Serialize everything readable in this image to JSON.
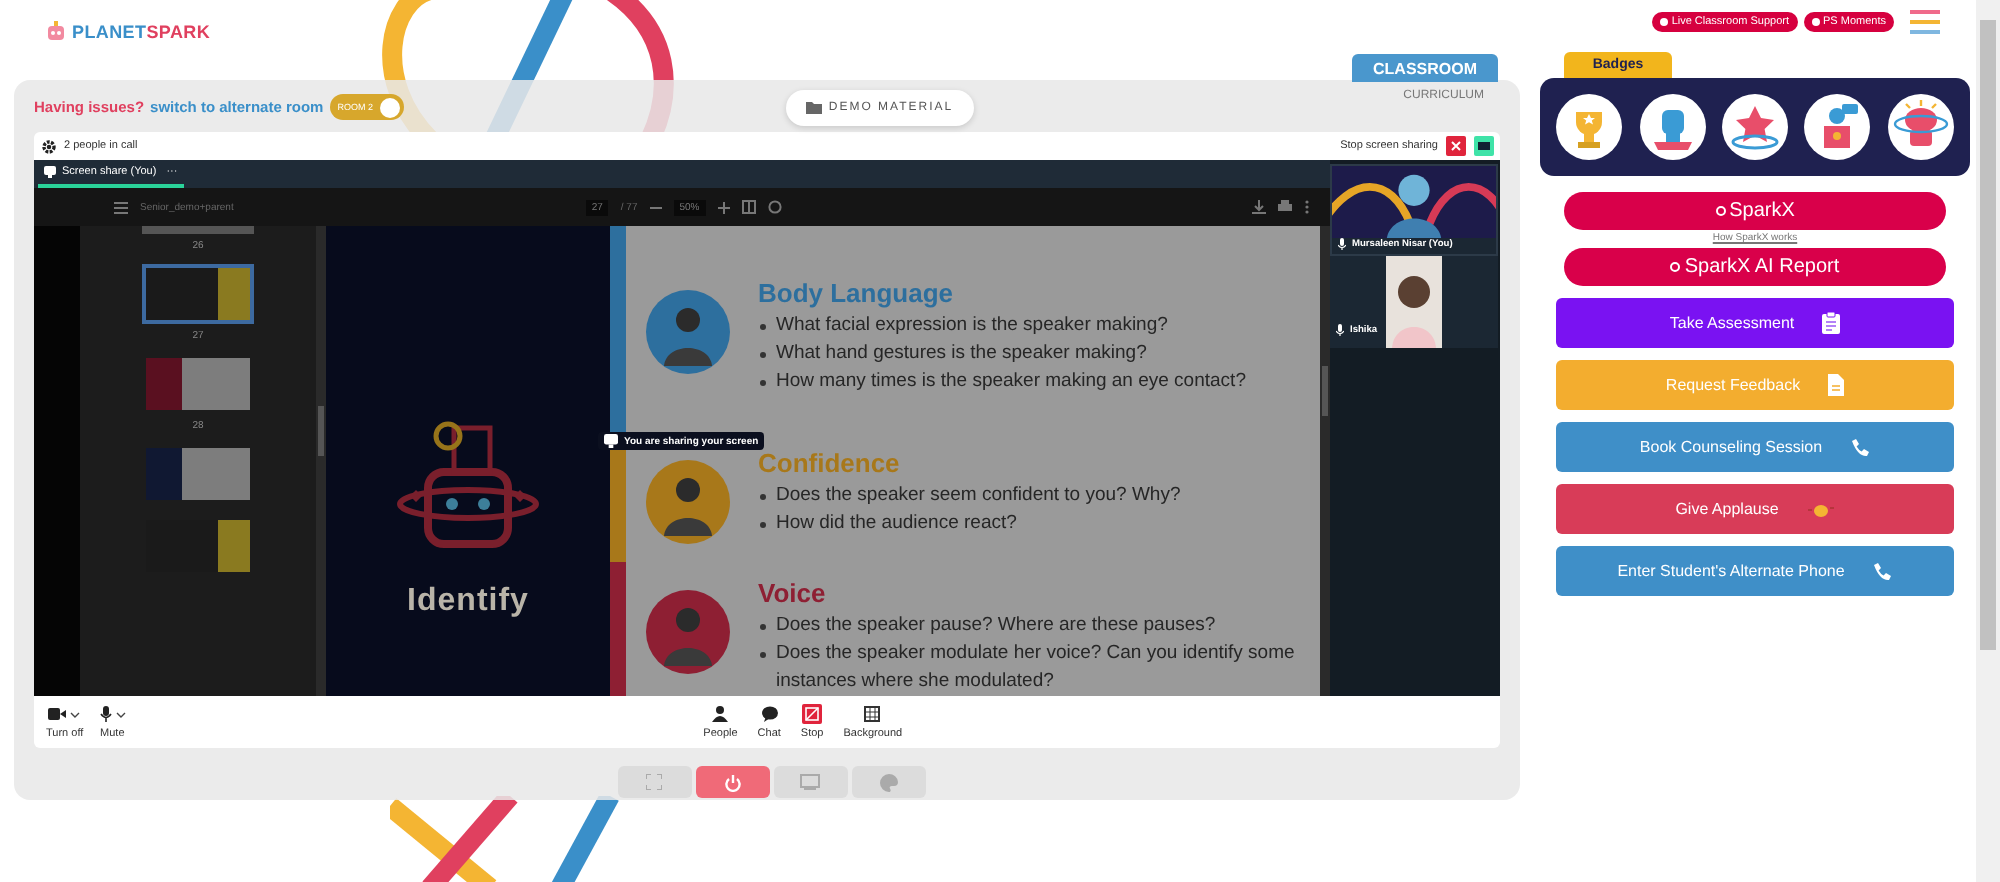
{
  "header": {
    "logo": {
      "first": "PLANET",
      "second": "SPARK"
    },
    "links": [
      {
        "label": "Live Classroom Support"
      },
      {
        "label": "PS Moments"
      }
    ]
  },
  "room": {
    "issue": "Having issues?",
    "switch": "switch to alternate room",
    "toggle": {
      "label": "ROOM 2",
      "on": true
    },
    "demo": "DEMO MATERIAL",
    "tabs": [
      {
        "label": "CLASSROOM",
        "selected": true
      },
      {
        "label": "CURRICULUM",
        "selected": false
      }
    ]
  },
  "call": {
    "count": "2 people in call",
    "stop_sharing": "Stop screen sharing",
    "share_tab": {
      "label": "Screen share (You)",
      "more": "···"
    },
    "viewer": {
      "file": "Senior_demo+parent",
      "page": "27",
      "pages": "/ 77",
      "zoom": "50%",
      "thumbnails": [
        {
          "page": "26",
          "selected": false
        },
        {
          "page": "27",
          "selected": true
        },
        {
          "page": "28",
          "selected": false
        },
        {
          "selected": false
        },
        {
          "selected": false
        }
      ]
    },
    "slide": {
      "title": "Identify",
      "sections": [
        {
          "heading": "Body Language",
          "color": "#2d6f9e",
          "bullets": [
            "What facial expression is the speaker making?",
            "What hand gestures is the speaker making?",
            "How many times is the speaker making an eye contact?"
          ]
        },
        {
          "heading": "Confidence",
          "color": "#a8781a",
          "bullets": [
            "Does the speaker seem confident to you? Why?",
            "How did the audience react?"
          ]
        },
        {
          "heading": "Voice",
          "color": "#8e1f33",
          "bullets": [
            "Does the speaker pause? Where are these pauses?",
            "Does the speaker modulate her voice? Can you identify some instances where she modulated?"
          ]
        }
      ]
    },
    "notice": "You are sharing your screen",
    "participants": [
      {
        "name": "Mursaleen Nisar (You)"
      },
      {
        "name": "Ishika"
      }
    ],
    "controls_left": [
      {
        "label": "Turn off",
        "kind": "camera",
        "menu": true
      },
      {
        "label": "Mute",
        "kind": "mic",
        "menu": true
      }
    ],
    "controls_center": [
      {
        "label": "People",
        "kind": "people",
        "menu": false
      },
      {
        "label": "Chat",
        "kind": "chat",
        "menu": false
      },
      {
        "label": "Stop",
        "kind": "stop",
        "menu": false
      },
      {
        "label": "Background",
        "kind": "background",
        "menu": false
      }
    ]
  },
  "room_actions": [
    {
      "kind": "fullscreen",
      "selected": false
    },
    {
      "kind": "power",
      "selected": true
    },
    {
      "kind": "screen",
      "selected": false
    },
    {
      "kind": "palette",
      "selected": false
    }
  ],
  "badges": {
    "title": "Badges",
    "items": [
      {
        "kind": "trophy"
      },
      {
        "kind": "fist"
      },
      {
        "kind": "star"
      },
      {
        "kind": "podium"
      },
      {
        "kind": "brain"
      }
    ]
  },
  "sparkx": {
    "button": "SparkX",
    "link": "How SparkX works",
    "report": "SparkX AI Report"
  },
  "actions": [
    {
      "label": "Take Assessment",
      "color": "#7a12f2",
      "kind": "clipboard"
    },
    {
      "label": "Request Feedback",
      "color": "#f3ad2f",
      "kind": "document"
    },
    {
      "label": "Book Counseling Session",
      "color": "#3f8fc8",
      "kind": "phone"
    },
    {
      "label": "Give Applause",
      "color": "#d83c58",
      "kind": "clap"
    },
    {
      "label": "Enter Student's Alternate Phone",
      "color": "#3f8fc8",
      "kind": "phone"
    }
  ]
}
